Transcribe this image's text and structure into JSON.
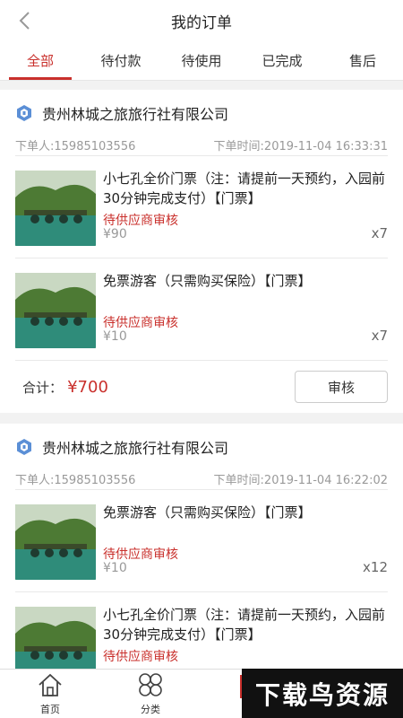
{
  "header": {
    "title": "我的订单"
  },
  "tabs": [
    {
      "label": "全部"
    },
    {
      "label": "待付款"
    },
    {
      "label": "待使用"
    },
    {
      "label": "已完成"
    },
    {
      "label": "售后"
    }
  ],
  "orders": [
    {
      "shop": "贵州林城之旅旅行社有限公司",
      "buyer": "下单人:15985103556",
      "time": "下单时间:2019-11-04 16:33:31",
      "items": [
        {
          "name": "小七孔全价门票（注：请提前一天预约，入园前30分钟完成支付）【门票】",
          "status": "待供应商审核",
          "price": "¥90",
          "qty": "x7"
        },
        {
          "name": "免票游客（只需购买保险）【门票】",
          "status": "待供应商审核",
          "price": "¥10",
          "qty": "x7"
        }
      ],
      "total_label": "合计：",
      "total_amount": "¥700",
      "action": "审核"
    },
    {
      "shop": "贵州林城之旅旅行社有限公司",
      "buyer": "下单人:15985103556",
      "time": "下单时间:2019-11-04 16:22:02",
      "items": [
        {
          "name": "免票游客（只需购买保险）【门票】",
          "status": "待供应商审核",
          "price": "¥10",
          "qty": "x12"
        },
        {
          "name": "小七孔全价门票（注：请提前一天预约，入园前30分钟完成支付）【门票】",
          "status": "待供应商审核",
          "price": "",
          "qty": ""
        }
      ]
    }
  ],
  "bottom_nav": [
    {
      "label": "首页",
      "icon": "home-icon"
    },
    {
      "label": "分类",
      "icon": "category-icon"
    }
  ],
  "watermark": "下载鸟资源"
}
